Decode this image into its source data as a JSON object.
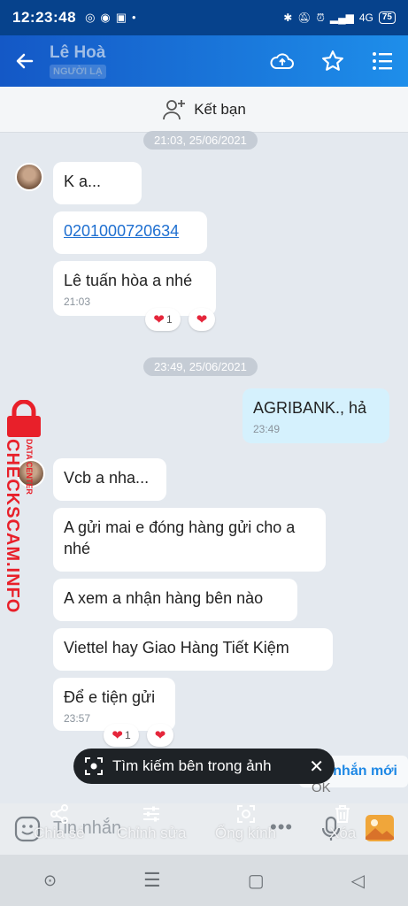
{
  "status": {
    "time": "12:23:48",
    "battery": "75",
    "network": "4G"
  },
  "header": {
    "name": "Lê Hoà",
    "badge": "NGƯỜI LẠ"
  },
  "add_friend": {
    "label": "Kết bạn"
  },
  "dates": [
    "21:03, 25/06/2021",
    "23:49, 25/06/2021"
  ],
  "messages": {
    "m1": "K a...",
    "m2": "0201000720634",
    "m3": "Lê tuấn hòa a nhé",
    "m3_time": "21:03",
    "m4": "AGRIBANK., hả",
    "m4_time": "23:49",
    "m5": "Vcb a nha...",
    "m6": "A gửi mai e đóng hàng gửi cho a nhé",
    "m7": "A xem a nhận hàng bên nào",
    "m8": "Viettel hay Giao Hàng Tiết Kiệm",
    "m9": "Để e tiện gửi",
    "m9_time": "23:57"
  },
  "reactions": {
    "r1_count": "1",
    "r2_count": "1"
  },
  "watermark": {
    "text": "CHECKSCAM.INFO",
    "sub": "DATA CENTER"
  },
  "new_message": {
    "label": "nhắn mới",
    "partial": "OK"
  },
  "lens_prompt": {
    "label": "Tìm kiếm bên trong ảnh"
  },
  "composer": {
    "placeholder": "Tin nhắn"
  },
  "tools": {
    "share": "Chia sẻ",
    "edit": "Chỉnh sửa",
    "lens": "Ống kính",
    "delete": "Xóa"
  },
  "colors": {
    "header_start": "#1458c6",
    "header_end": "#1e8eea",
    "sent_bubble": "#d5f1fd",
    "heart": "#e5263b",
    "watermark": "#e8202a"
  }
}
